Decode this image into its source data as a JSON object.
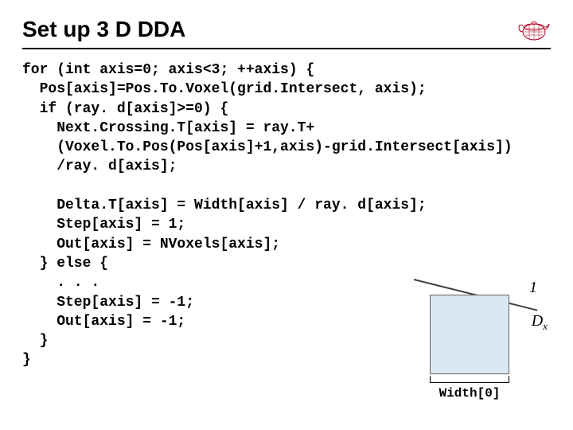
{
  "title": "Set up 3 D DDA",
  "logo_name": "utah-teapot-logo",
  "code_lines": [
    "for (int axis=0; axis<3; ++axis) {",
    "  Pos[axis]=Pos.To.Voxel(grid.Intersect, axis);",
    "  if (ray. d[axis]>=0) {",
    "    Next.Crossing.T[axis] = ray.T+",
    "    (Voxel.To.Pos(Pos[axis]+1,axis)-grid.Intersect[axis])",
    "    /ray. d[axis];",
    "",
    "    Delta.T[axis] = Width[axis] / ray. d[axis];",
    "    Step[axis] = 1;",
    "    Out[axis] = NVoxels[axis];",
    "  } else {",
    "    . . .",
    "    Step[axis] = -1;",
    "    Out[axis] = -1;",
    "  }",
    "}"
  ],
  "diagram": {
    "one_label": "1",
    "dx_label": "D",
    "dx_sub": "x",
    "width_label": "Width[0]"
  }
}
